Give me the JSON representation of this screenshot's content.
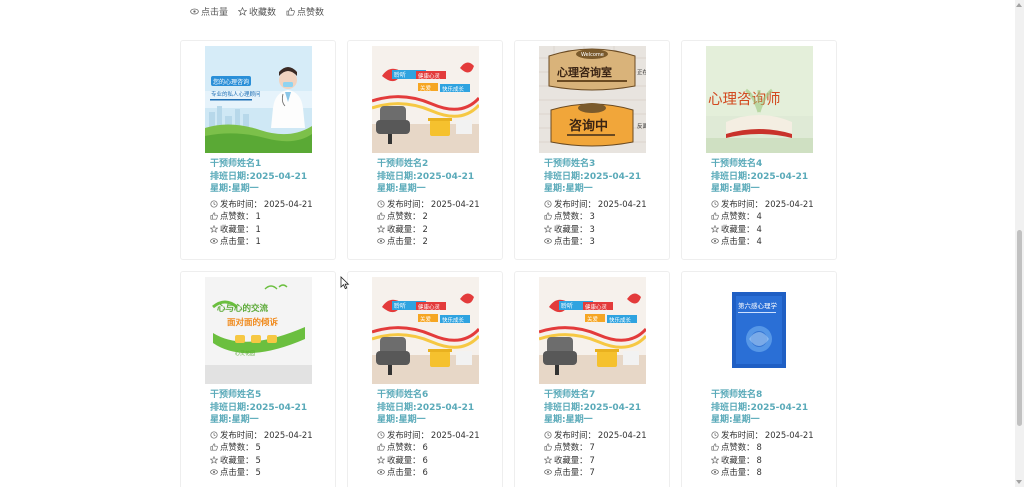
{
  "sort": [
    {
      "label": "点击量",
      "icon": "eye-icon"
    },
    {
      "label": "收藏数",
      "icon": "star-icon"
    },
    {
      "label": "点赞数",
      "icon": "thumbs-up-icon"
    }
  ],
  "labels": {
    "publish": "发布时间：",
    "likes": "点赞数：",
    "favorites": "收藏量：",
    "clicks": "点击量："
  },
  "cards": [
    {
      "name": "干预师姓名1",
      "date": "排班日期:2025-04-21",
      "week": "星期:星期一",
      "publish_time": "2025-04-21",
      "likes": "1",
      "favorites": "1",
      "clicks": "1",
      "image": "doctor-banner-image",
      "image_text": [
        "您的心理咨询",
        "专业的私人心理顾问"
      ]
    },
    {
      "name": "干预师姓名2",
      "date": "排班日期:2025-04-21",
      "week": "星期:星期一",
      "publish_time": "2025-04-21",
      "likes": "2",
      "favorites": "2",
      "clicks": "2",
      "image": "counseling-room-wall-image",
      "image_text": [
        "聆听",
        "健康心灵",
        "关爱",
        "快乐成长"
      ]
    },
    {
      "name": "干预师姓名3",
      "date": "排班日期:2025-04-21",
      "week": "星期:星期一",
      "publish_time": "2025-04-21",
      "likes": "3",
      "favorites": "3",
      "clicks": "3",
      "image": "consulting-room-sign-image",
      "image_text": [
        "Welcome",
        "心理咨询室",
        "咨询中",
        "正在",
        "反面"
      ]
    },
    {
      "name": "干预师姓名4",
      "date": "排班日期:2025-04-21",
      "week": "星期:星期一",
      "publish_time": "2025-04-21",
      "likes": "4",
      "favorites": "4",
      "clicks": "4",
      "image": "counselor-book-image",
      "image_text": [
        "心理咨询师"
      ]
    },
    {
      "name": "干预师姓名5",
      "date": "排班日期:2025-04-21",
      "week": "星期:星期一",
      "publish_time": "2025-04-21",
      "likes": "5",
      "favorites": "5",
      "clicks": "5",
      "image": "heart-to-heart-wall-image",
      "image_text": [
        "心与心的交流",
        "面对面的倾诉"
      ]
    },
    {
      "name": "干预师姓名6",
      "date": "排班日期:2025-04-21",
      "week": "星期:星期一",
      "publish_time": "2025-04-21",
      "likes": "6",
      "favorites": "6",
      "clicks": "6",
      "image": "counseling-room-wall-image",
      "image_text": [
        "聆听",
        "健康心灵",
        "关爱",
        "快乐成长"
      ]
    },
    {
      "name": "干预师姓名7",
      "date": "排班日期:2025-04-21",
      "week": "星期:星期一",
      "publish_time": "2025-04-21",
      "likes": "7",
      "favorites": "7",
      "clicks": "7",
      "image": "counseling-room-wall-image",
      "image_text": [
        "聆听",
        "健康心灵",
        "关爱",
        "快乐成长"
      ]
    },
    {
      "name": "干预师姓名8",
      "date": "排班日期:2025-04-21",
      "week": "星期:星期一",
      "publish_time": "2025-04-21",
      "likes": "8",
      "favorites": "8",
      "clicks": "8",
      "image": "psychology-book-cover-image",
      "image_text": [
        "第六感心理学"
      ]
    }
  ],
  "colors": {
    "accent": "#5aaab9",
    "text": "#333333",
    "border": "#eeeeee"
  }
}
